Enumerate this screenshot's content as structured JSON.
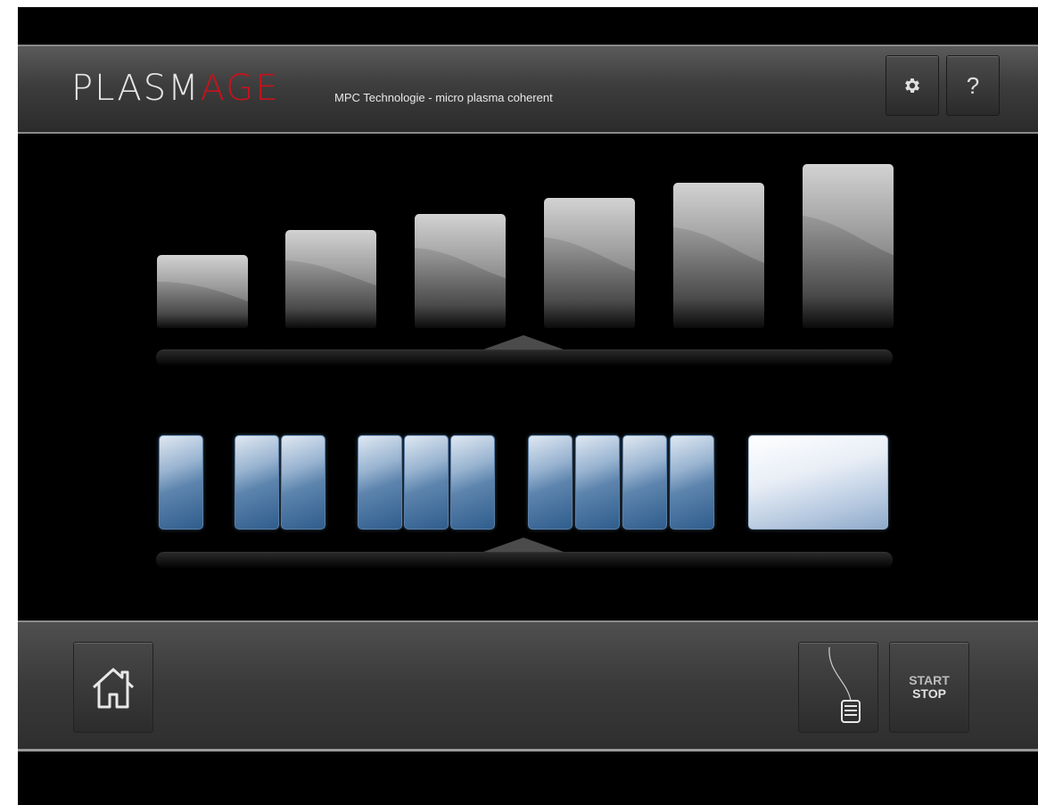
{
  "header": {
    "logo_main": "PLASM",
    "logo_accent": "AGE",
    "tagline": "MPC Technologie - micro plasma coherent",
    "settings_icon": "gear-icon",
    "help_label": "?"
  },
  "power_levels": {
    "count": 6,
    "selected_level": 3
  },
  "pulse_modes": {
    "groups": [
      1,
      2,
      3,
      4,
      "continuous"
    ],
    "selected_group": 3
  },
  "footer": {
    "home_icon": "home-icon",
    "pedal_icon": "foot-pedal-icon",
    "start_label": "START",
    "stop_label": "STOP"
  },
  "colors": {
    "accent": "#c8121c",
    "pulse_blue": "#2f5d8d"
  }
}
